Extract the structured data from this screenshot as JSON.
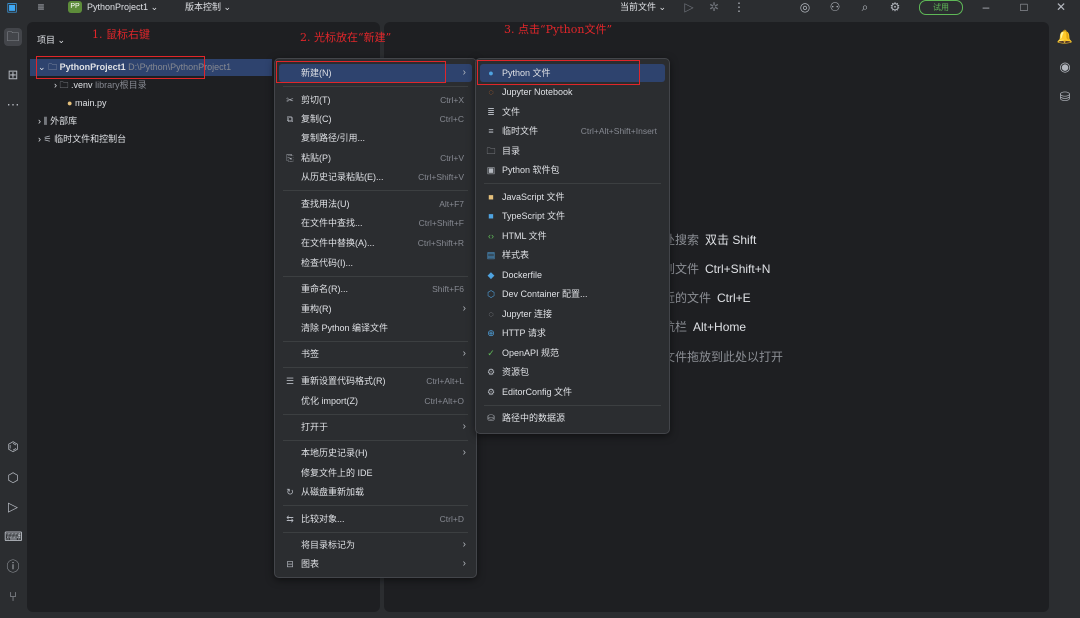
{
  "titlebar": {
    "project_badge": "PP",
    "project_name": "PythonProject1",
    "vcs": "版本控制",
    "run_config": "当前文件",
    "trial": "试用"
  },
  "project_panel": {
    "header": "项目",
    "root_name": "PythonProject1",
    "root_path": "D:\\Python\\PythonProject1",
    "venv_name": ".venv",
    "venv_note": "library根目录",
    "main_file": "main.py",
    "external_libs": "外部库",
    "scratches": "临时文件和控制台"
  },
  "hints": [
    {
      "text": "处搜索",
      "key": "双击 Shift"
    },
    {
      "text": "到文件",
      "key": "Ctrl+Shift+N"
    },
    {
      "text": "近的文件",
      "key": "Ctrl+E"
    },
    {
      "text": "航栏",
      "key": "Alt+Home"
    },
    {
      "text": "文件拖放到此处以打开",
      "key": ""
    }
  ],
  "context_menu": {
    "new": "新建(N)",
    "cut": "剪切(T)",
    "cut_sc": "Ctrl+X",
    "copy": "复制(C)",
    "copy_sc": "Ctrl+C",
    "copy_path": "复制路径/引用...",
    "paste": "粘贴(P)",
    "paste_sc": "Ctrl+V",
    "paste_history": "从历史记录粘贴(E)...",
    "paste_history_sc": "Ctrl+Shift+V",
    "find_usages": "查找用法(U)",
    "find_usages_sc": "Alt+F7",
    "find_in_files": "在文件中查找...",
    "find_in_files_sc": "Ctrl+Shift+F",
    "replace_in_files": "在文件中替换(A)...",
    "replace_in_files_sc": "Ctrl+Shift+R",
    "inspect": "检查代码(I)...",
    "rename": "重命名(R)...",
    "rename_sc": "Shift+F6",
    "refactor": "重构(R)",
    "clean_python": "清除 Python 编译文件",
    "bookmarks": "书签",
    "reformat": "重新设置代码格式(R)",
    "reformat_sc": "Ctrl+Alt+L",
    "optimize": "优化 import(Z)",
    "optimize_sc": "Ctrl+Alt+O",
    "open_in": "打开于",
    "local_history": "本地历史记录(H)",
    "repair_ide": "修复文件上的 IDE",
    "reload": "从磁盘重新加载",
    "compare": "比较对象...",
    "compare_sc": "Ctrl+D",
    "mark_dir": "将目录标记为",
    "diagrams": "图表"
  },
  "new_submenu": {
    "python_file": "Python 文件",
    "jupyter": "Jupyter Notebook",
    "file": "文件",
    "scratch": "临时文件",
    "scratch_sc": "Ctrl+Alt+Shift+Insert",
    "directory": "目录",
    "python_package": "Python 软件包",
    "javascript": "JavaScript 文件",
    "typescript": "TypeScript 文件",
    "html": "HTML 文件",
    "stylesheet": "样式表",
    "dockerfile": "Dockerfile",
    "devcontainer": "Dev Container 配置...",
    "jupyter_conn": "Jupyter 连接",
    "http": "HTTP 请求",
    "openapi": "OpenAPI 规范",
    "resource": "资源包",
    "editorconfig": "EditorConfig 文件",
    "datasource": "路径中的数据源"
  },
  "annotations": {
    "step1": "1. 鼠标右键",
    "step2": "2. 光标放在“新建”",
    "step3": "3. 点击“Python文件”"
  },
  "colors": {
    "annotation": "#e0262a",
    "selection": "#2e436e",
    "trial": "#5fb857"
  }
}
